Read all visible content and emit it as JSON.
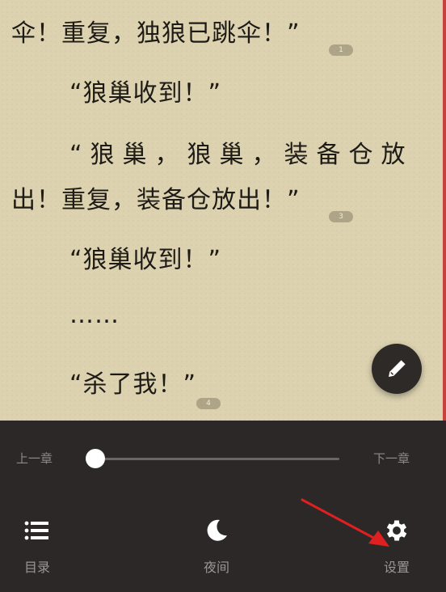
{
  "reader": {
    "lines": [
      "伞！重复，独狼已跳伞！”",
      "“狼巢收到！”",
      "“狼巢，狼巢，装备仓放",
      "出！重复，装备仓放出！”",
      "“狼巢收到！”",
      "……",
      "“杀了我！”"
    ],
    "notes": [
      "1",
      "3",
      "4"
    ]
  },
  "panel": {
    "prev_chapter": "上一章",
    "next_chapter": "下一章",
    "progress": 0.0,
    "nav": {
      "toc": "目录",
      "night": "夜间",
      "settings": "设置"
    }
  },
  "colors": {
    "paper": "#dcd2b0",
    "panel": "#2c2828",
    "annotation_arrow": "#e02020"
  }
}
